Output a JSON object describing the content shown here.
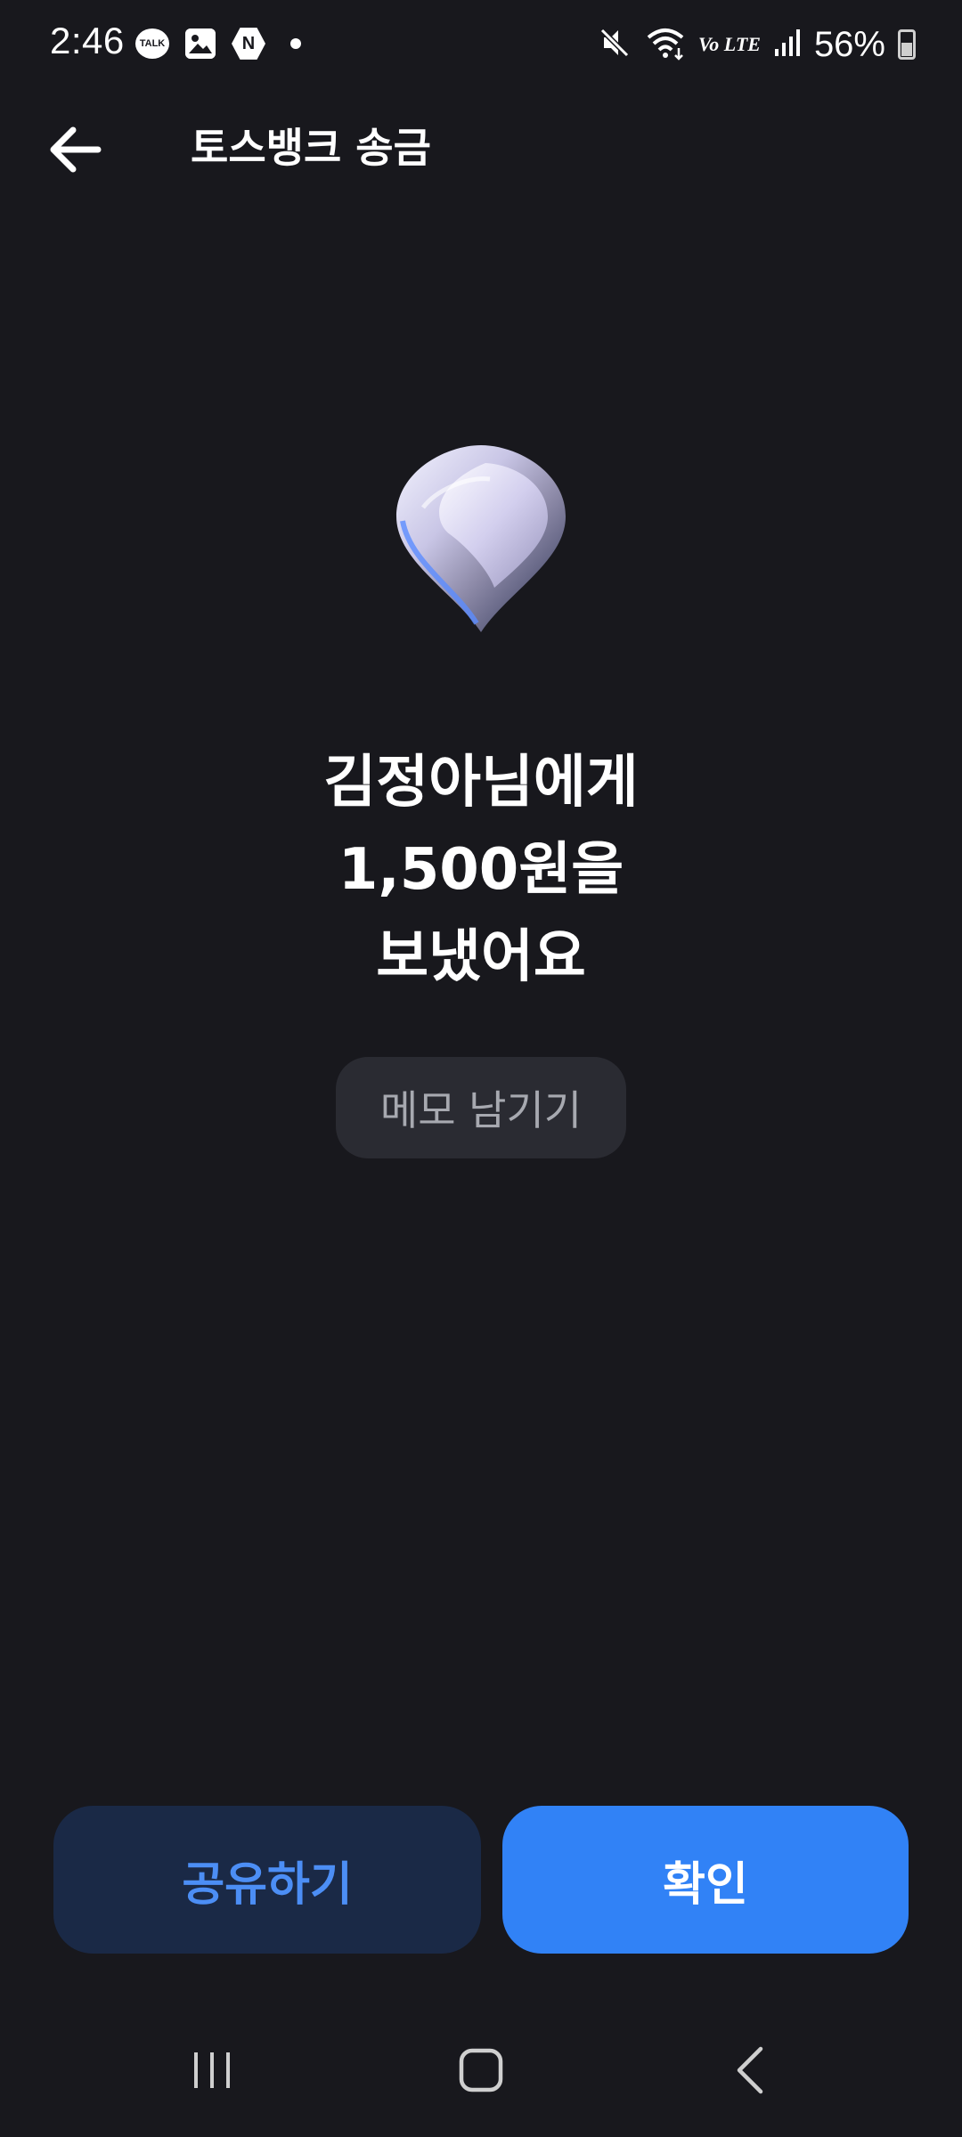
{
  "status_bar": {
    "time": "2:46",
    "talk_badge": "TALK",
    "n_badge": "N",
    "network": "Vo LTE",
    "battery": "56%"
  },
  "header": {
    "title": "토스뱅크 송금"
  },
  "main": {
    "message_line1": "김정아님에게",
    "message_line2": "1,500원을",
    "message_line3": "보냈어요",
    "memo_label": "메모 남기기"
  },
  "actions": {
    "share_label": "공유하기",
    "confirm_label": "확인"
  },
  "colors": {
    "background": "#18181d",
    "primary": "#3182f6",
    "share_bg": "#1a2946",
    "share_text": "#4c8ef5",
    "memo_bg": "#2a2b32"
  }
}
